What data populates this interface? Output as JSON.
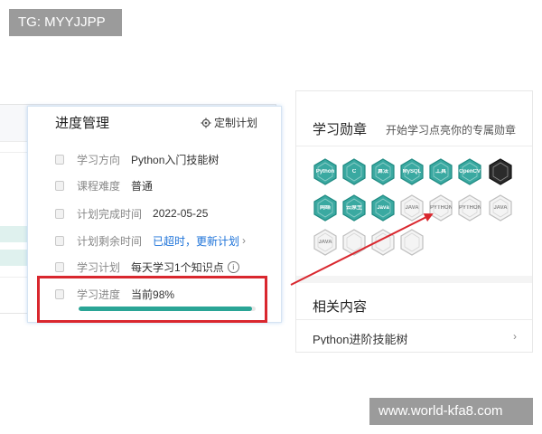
{
  "watermarks": {
    "top": "TG: MYYJJPP",
    "bottom": "www.world-kfa8.com"
  },
  "progress_card": {
    "title": "进度管理",
    "settings_label": "定制计划",
    "rows": [
      {
        "label": "学习方向",
        "value": "Python入门技能树"
      },
      {
        "label": "课程难度",
        "value": "普通"
      },
      {
        "label": "计划完成时间",
        "value": "2022-05-25"
      },
      {
        "label": "计划剩余时间",
        "value_status": "已超时，",
        "value_link": "更新计划"
      },
      {
        "label": "学习计划",
        "value": "每天学习1个知识点"
      },
      {
        "label": "学习进度",
        "value": "当前98%"
      }
    ],
    "progress_percent": 98
  },
  "badges_panel": {
    "title": "学习勋章",
    "subtitle": "开始学习点亮你的专属勋章",
    "badges": [
      {
        "label": "Python",
        "state": "active"
      },
      {
        "label": "C",
        "state": "active"
      },
      {
        "label": "算法",
        "state": "active"
      },
      {
        "label": "MySQL",
        "state": "active"
      },
      {
        "label": "工具",
        "state": "active"
      },
      {
        "label": "OpenCV",
        "state": "active"
      },
      {
        "label": "",
        "state": "dark"
      },
      {
        "label": "网络",
        "state": "active"
      },
      {
        "label": "云原生",
        "state": "active"
      },
      {
        "label": "Java",
        "state": "active"
      },
      {
        "label": "JAVA",
        "state": "locked"
      },
      {
        "label": "PYTHON",
        "state": "locked"
      },
      {
        "label": "PYTHON",
        "state": "locked"
      },
      {
        "label": "JAVA",
        "state": "locked"
      },
      {
        "label": "JAVA",
        "state": "locked"
      },
      {
        "label": "",
        "state": "locked"
      },
      {
        "label": "",
        "state": "locked"
      },
      {
        "label": "",
        "state": "locked"
      }
    ]
  },
  "related_panel": {
    "title": "相关内容",
    "items": [
      {
        "label": "Python进阶技能树"
      }
    ]
  },
  "colors": {
    "accent": "#2aa596",
    "badge_active_fill": "#3aa9a1",
    "badge_active_stroke": "#1f8a82",
    "badge_locked_fill": "#f4f4f4",
    "badge_locked_stroke": "#bfbfbf",
    "badge_dark_fill": "#2b2b2b",
    "link": "#1e73d9",
    "annotation": "#d9272e"
  }
}
